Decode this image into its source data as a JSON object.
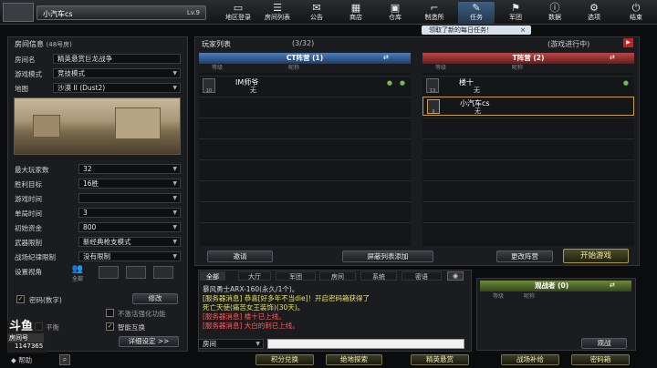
{
  "topbar": {
    "player_name": "小汽车cs",
    "level": "Lv.9",
    "nav": [
      {
        "label": "地区登录",
        "icon": "monitor-icon"
      },
      {
        "label": "房间列表",
        "icon": "list-icon"
      },
      {
        "label": "公告",
        "icon": "megaphone-icon"
      },
      {
        "label": "商店",
        "icon": "shop-icon"
      },
      {
        "label": "仓库",
        "icon": "warehouse-icon"
      },
      {
        "label": "制造所",
        "icon": "gun-icon"
      },
      {
        "label": "任务",
        "icon": "task-icon"
      },
      {
        "label": "军团",
        "icon": "clan-icon"
      },
      {
        "label": "数据",
        "icon": "info-icon"
      },
      {
        "label": "选项",
        "icon": "gear-icon"
      },
      {
        "label": "结束",
        "icon": "power-icon"
      }
    ],
    "mission_notice": "领取了新的每日任务！",
    "mission_close": "×"
  },
  "room": {
    "header": "房间信息",
    "room_no": "(48号房)",
    "fields": [
      {
        "label": "房间名",
        "value": "精英悬赏巨龙战争"
      },
      {
        "label": "游戏模式",
        "value": "竞技模式"
      },
      {
        "label": "地图",
        "value": "沙漠 II (Dust2)"
      }
    ],
    "settings": [
      {
        "label": "最大玩家数",
        "value": "32"
      },
      {
        "label": "胜利目标",
        "value": "16胜"
      },
      {
        "label": "游戏时间",
        "value": ""
      },
      {
        "label": "单局时间",
        "value": "3"
      },
      {
        "label": "初始资金",
        "value": "800"
      },
      {
        "label": "武器限制",
        "value": "新经典枪支模式"
      },
      {
        "label": "战场纪律限制",
        "value": "没有限制"
      }
    ],
    "view_label": "设置视角",
    "view_options": [
      "全部",
      "",
      "",
      ""
    ],
    "password_label": "密码(数字)",
    "modify_btn": "修改",
    "no_team_label": "不激活强化功能",
    "balance_label": "平衡",
    "auto_team_label": "智能互换",
    "detail_btn": "详细设定 >>"
  },
  "streamer": {
    "logo": "斗鱼",
    "sub": "房间号",
    "room_id": "1147365"
  },
  "help_label": "帮助",
  "players": {
    "header": "玩家列表",
    "count": "(3/32)",
    "status": "(游戏进行中)",
    "ct_team": "CT阵营 (1)",
    "t_team": "T阵营 (2)",
    "col_level": "等级",
    "col_name": "昵称",
    "ct": [
      {
        "rank": "10",
        "name": "IM师爷",
        "status": "无"
      }
    ],
    "t": [
      {
        "rank": "13",
        "name": "楼十",
        "status": "无"
      },
      {
        "rank": "9",
        "name": "小汽车cs",
        "status": "无"
      }
    ],
    "invite_btn": "邀请",
    "mask_btn": "屏蔽列表添加",
    "change_team_btn": "更改阵营",
    "start_btn": "开始游戏"
  },
  "chat": {
    "tabs": [
      "全部",
      "大厅",
      "军团",
      "房间",
      "系统",
      "密语"
    ],
    "messages": [
      {
        "text": "暴风勇士ARX-160(永久/1个)。",
        "color": "#d8d8d8"
      },
      {
        "text": "[服务器消息] 恭喜[好多年不当die]！开启密码箱获得了",
        "color": "#e6e36a"
      },
      {
        "text": "死亡天使(痛苦女王装饰)(30天)。",
        "color": "#e6e36a"
      },
      {
        "text": "[服务器消息] 楼十已上线。",
        "color": "#ff5a5a"
      },
      {
        "text": "[服务器消息] 大白的刺已上线。",
        "color": "#ff5a5a"
      }
    ],
    "channel": "房间"
  },
  "spectators": {
    "header": "观战者 (0)",
    "spectate_btn": "观战"
  },
  "bottom_buttons": [
    "积分兑换",
    "绝地探索",
    "精英悬赏",
    "战场补给",
    "密码箱"
  ]
}
